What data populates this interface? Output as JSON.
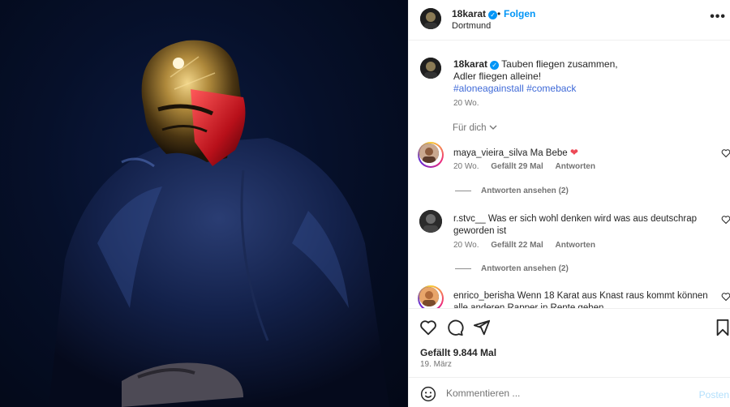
{
  "post": {
    "username": "18karat",
    "verified": true,
    "follow_label": "Folgen",
    "separator": "•",
    "location": "Dortmund",
    "more_label": "•••"
  },
  "caption": {
    "username": "18karat",
    "line1": "Tauben fliegen zusammen,",
    "line2": "Adler fliegen alleine!",
    "hashtags": "#aloneagainstall #comeback",
    "time": "20 Wo."
  },
  "for_you": "Für dich",
  "comments": [
    {
      "username": "maya_vieira_silva",
      "text": "Ma Bebe",
      "time": "20 Wo.",
      "likes": "Gefällt 29 Mal",
      "reply_label": "Antworten",
      "view_replies": "Antworten ansehen (2)"
    },
    {
      "username": "r.stvc__",
      "text": "Was er sich wohl denken wird was aus deutschrap geworden ist",
      "time": "20 Wo.",
      "likes": "Gefällt 22 Mal",
      "reply_label": "Antworten",
      "view_replies": "Antworten ansehen (2)"
    },
    {
      "username": "enrico_berisha",
      "text": "Wenn 18 Karat aus Knast raus kommt können alle anderen Rapper in Rente gehen"
    }
  ],
  "footer": {
    "likes": "Gefällt 9.844 Mal",
    "date": "19. März",
    "comment_placeholder": "Kommentieren ...",
    "post_label": "Posten"
  },
  "colors": {
    "accent": "#0095f6",
    "like_heart": "#ed4956"
  },
  "icons": [
    "heart-icon",
    "comment-icon",
    "share-icon",
    "bookmark-icon",
    "emoji-icon",
    "verified-badge-icon",
    "more-options-icon"
  ]
}
